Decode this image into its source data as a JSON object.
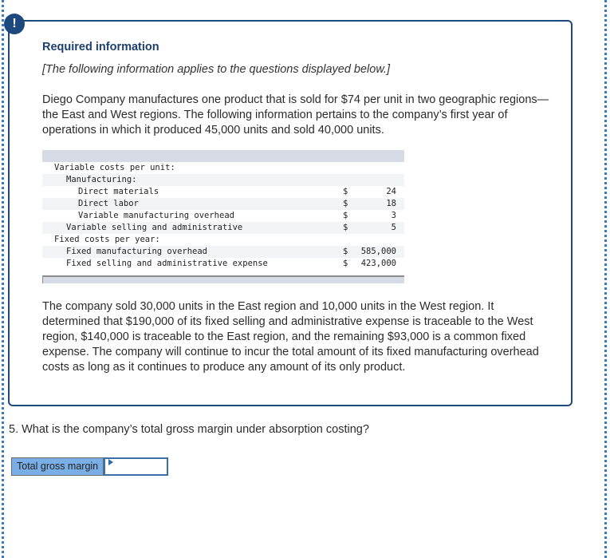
{
  "header": {
    "icon": "exclamation-icon",
    "title": "Required information",
    "subtitle": "[The following information applies to the questions displayed below.]"
  },
  "intro_paragraph": "Diego Company manufactures one product that is sold for $74 per unit in two geographic regions—the East and West regions. The following information pertains to the company’s first year of operations in which it produced 45,000 units and sold 40,000 units.",
  "cost_table": {
    "rows": [
      {
        "label": "Variable costs per unit:",
        "indent": 0,
        "dollar": "",
        "value": ""
      },
      {
        "label": "Manufacturing:",
        "indent": 1,
        "dollar": "",
        "value": ""
      },
      {
        "label": "Direct materials",
        "indent": 2,
        "dollar": "$",
        "value": "24"
      },
      {
        "label": "Direct labor",
        "indent": 2,
        "dollar": "$",
        "value": "18"
      },
      {
        "label": "Variable manufacturing overhead",
        "indent": 2,
        "dollar": "$",
        "value": "3"
      },
      {
        "label": "Variable selling and administrative",
        "indent": 1,
        "dollar": "$",
        "value": "5"
      },
      {
        "label": "Fixed costs per year:",
        "indent": 0,
        "dollar": "",
        "value": ""
      },
      {
        "label": "Fixed manufacturing overhead",
        "indent": 1,
        "dollar": "$",
        "value": "585,000"
      },
      {
        "label": "Fixed selling and administrative expense",
        "indent": 1,
        "dollar": "$",
        "value": "423,000"
      }
    ]
  },
  "second_paragraph": "The company sold 30,000 units in the East region and 10,000 units in the West region. It determined that $190,000 of its fixed selling and administrative expense is traceable to the West region, $140,000 is traceable to the East region, and the remaining $93,000 is a common fixed expense. The company will continue to incur the total amount of its fixed manufacturing overhead costs as long as it continues to produce any amount of its only product.",
  "question": {
    "text": "5. What is the company’s total gross margin under absorption costing?",
    "answer_label": "Total gross margin",
    "answer_value": ""
  }
}
